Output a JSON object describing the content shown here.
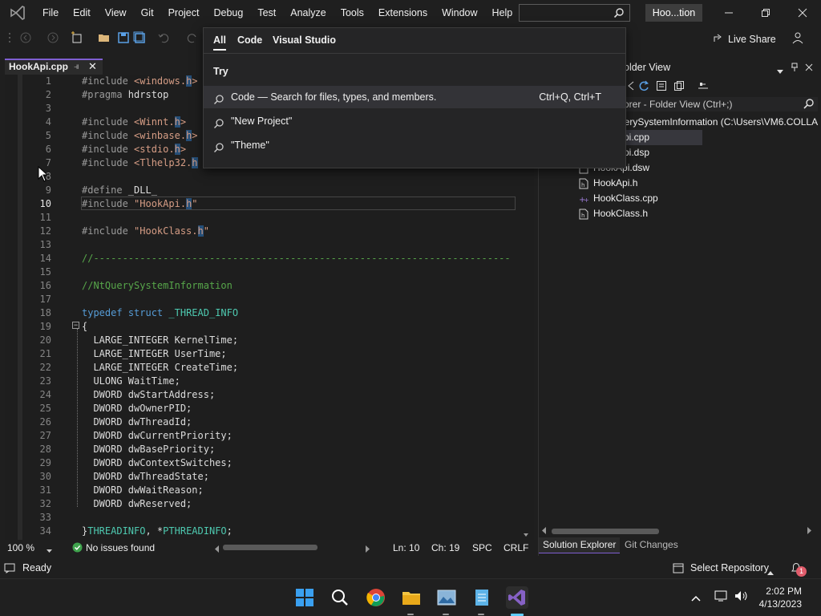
{
  "menu": [
    "File",
    "Edit",
    "View",
    "Git",
    "Project",
    "Debug",
    "Test",
    "Analyze",
    "Tools",
    "Extensions",
    "Window",
    "Help"
  ],
  "title_solution": "Hoo...tion",
  "toolbar": {
    "live_share": "Live Share"
  },
  "editor_tab": {
    "filename": "HookApi.cpp",
    "pin": "⼀",
    "close": "✕"
  },
  "code_lines": [
    {
      "n": "1",
      "html": "<span class=\"pre\">#include</span> <span class=\"str\">&lt;windows.<span class=\"hl\">h</span>&gt;</span>"
    },
    {
      "n": "2",
      "html": "<span class=\"pre\">#pragma</span> hdrstop"
    },
    {
      "n": "3",
      "html": ""
    },
    {
      "n": "4",
      "html": "<span class=\"pre\">#include</span> <span class=\"str\">&lt;Winnt.<span class=\"hl\">h</span>&gt;</span>"
    },
    {
      "n": "5",
      "html": "<span class=\"pre\">#include</span> <span class=\"str\">&lt;winbase.<span class=\"hl\">h</span>&gt;</span>"
    },
    {
      "n": "6",
      "html": "<span class=\"pre\">#include</span> <span class=\"str\">&lt;stdio.<span class=\"hl\">h</span>&gt;</span>"
    },
    {
      "n": "7",
      "html": "<span class=\"pre\">#include</span> <span class=\"str\">&lt;Tlhelp32.<span class=\"hl\">h</span></span>"
    },
    {
      "n": "8",
      "html": ""
    },
    {
      "n": "9",
      "html": "<span class=\"pre\">#define</span> _DLL_"
    },
    {
      "n": "10",
      "html": "<span class=\"pre\">#include</span> <span class=\"str\">\"HookApi.<span class=\"hl\">h</span>\"</span>"
    },
    {
      "n": "11",
      "html": ""
    },
    {
      "n": "12",
      "html": "<span class=\"pre\">#include</span> <span class=\"str\">\"HookClass.<span class=\"hl\">h</span>\"</span>"
    },
    {
      "n": "13",
      "html": ""
    },
    {
      "n": "14",
      "html": "<span class=\"cm\">//------------------------------------------------------------------------</span>"
    },
    {
      "n": "15",
      "html": ""
    },
    {
      "n": "16",
      "html": "<span class=\"cm\">//NtQuerySystemInformation</span>"
    },
    {
      "n": "17",
      "html": ""
    },
    {
      "n": "18",
      "html": "<span class=\"kw\">typedef</span> <span class=\"kw\">struct</span> <span class=\"ty\">_THREAD_INFO</span>"
    },
    {
      "n": "19",
      "html": "{"
    },
    {
      "n": "20",
      "html": "  LARGE_INTEGER KernelTime;"
    },
    {
      "n": "21",
      "html": "  LARGE_INTEGER UserTime;"
    },
    {
      "n": "22",
      "html": "  LARGE_INTEGER CreateTime;"
    },
    {
      "n": "23",
      "html": "  ULONG WaitTime;"
    },
    {
      "n": "24",
      "html": "  DWORD dwStartAddress;"
    },
    {
      "n": "25",
      "html": "  DWORD dwOwnerPID;"
    },
    {
      "n": "26",
      "html": "  DWORD dwThreadId;"
    },
    {
      "n": "27",
      "html": "  DWORD dwCurrentPriority;"
    },
    {
      "n": "28",
      "html": "  DWORD dwBasePriority;"
    },
    {
      "n": "29",
      "html": "  DWORD dwContextSwitches;"
    },
    {
      "n": "30",
      "html": "  DWORD dwThreadState;"
    },
    {
      "n": "31",
      "html": "  DWORD dwWaitReason;"
    },
    {
      "n": "32",
      "html": "  DWORD dwReserved;"
    },
    {
      "n": "33",
      "html": ""
    },
    {
      "n": "34",
      "html": "}<span class=\"ty\">THREADINFO</span>, *<span class=\"ty\">PTHREADINFO</span>;"
    }
  ],
  "current_line": "10",
  "editor_status": {
    "zoom": "100 %",
    "issues": "No issues found",
    "line": "Ln: 10",
    "col": "Ch: 19",
    "spc": "SPC",
    "eol": "CRLF"
  },
  "solution_explorer": {
    "header": "older View",
    "search_placeholder": "orer - Folder View (Ctrl+;)",
    "root": "ierySystemInformation (C:\\Users\\VM6.COLLA",
    "items": [
      "pi.cpp",
      "pi.dsp",
      "HookApi.dsw",
      "HookApi.h",
      "HookClass.cpp",
      "HookClass.h"
    ],
    "tabs": [
      "Solution Explorer",
      "Git Changes"
    ]
  },
  "search_popup": {
    "tabs": [
      "All",
      "Code",
      "Visual Studio"
    ],
    "try_label": "Try",
    "rows": [
      {
        "text": "Code — Search for files, types, and members.",
        "shortcut": "Ctrl+Q, Ctrl+T"
      },
      {
        "text": "\"New Project\"",
        "shortcut": ""
      },
      {
        "text": "\"Theme\"",
        "shortcut": ""
      }
    ]
  },
  "statusbar": {
    "ready": "Ready",
    "select_repo": "Select Repository",
    "notif_count": "1"
  },
  "clock": {
    "time": "2:02 PM",
    "date": "4/13/2023"
  },
  "colors": {
    "accent": "#7f5fd2",
    "keyword": "#569cd6",
    "string": "#d69d85",
    "comment": "#57a64a",
    "type": "#4ec9b0"
  }
}
